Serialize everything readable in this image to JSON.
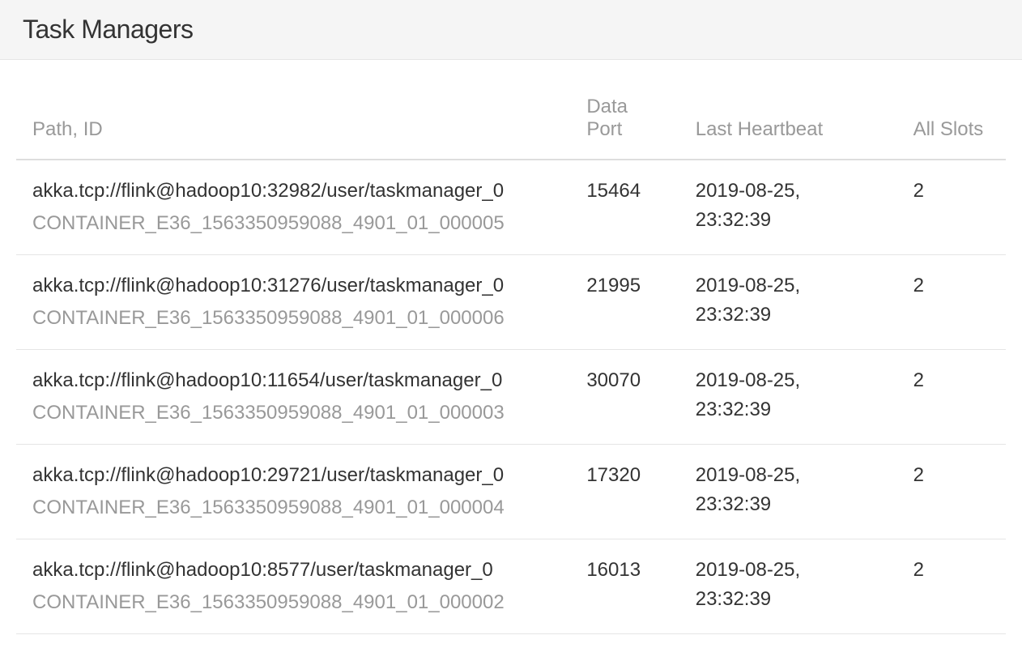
{
  "header": {
    "title": "Task Managers"
  },
  "table": {
    "columns": {
      "path": "Path, ID",
      "dataPort": "Data Port",
      "lastHeartbeat": "Last Heartbeat",
      "allSlots": "All Slots"
    },
    "rows": [
      {
        "path": "akka.tcp://flink@hadoop10:32982/user/taskmanager_0",
        "containerId": "CONTAINER_E36_1563350959088_4901_01_000005",
        "dataPort": "15464",
        "lastHeartbeat": "2019-08-25, 23:32:39",
        "allSlots": "2"
      },
      {
        "path": "akka.tcp://flink@hadoop10:31276/user/taskmanager_0",
        "containerId": "CONTAINER_E36_1563350959088_4901_01_000006",
        "dataPort": "21995",
        "lastHeartbeat": "2019-08-25, 23:32:39",
        "allSlots": "2"
      },
      {
        "path": "akka.tcp://flink@hadoop10:11654/user/taskmanager_0",
        "containerId": "CONTAINER_E36_1563350959088_4901_01_000003",
        "dataPort": "30070",
        "lastHeartbeat": "2019-08-25, 23:32:39",
        "allSlots": "2"
      },
      {
        "path": "akka.tcp://flink@hadoop10:29721/user/taskmanager_0",
        "containerId": "CONTAINER_E36_1563350959088_4901_01_000004",
        "dataPort": "17320",
        "lastHeartbeat": "2019-08-25, 23:32:39",
        "allSlots": "2"
      },
      {
        "path": "akka.tcp://flink@hadoop10:8577/user/taskmanager_0",
        "containerId": "CONTAINER_E36_1563350959088_4901_01_000002",
        "dataPort": "16013",
        "lastHeartbeat": "2019-08-25, 23:32:39",
        "allSlots": "2"
      }
    ]
  }
}
